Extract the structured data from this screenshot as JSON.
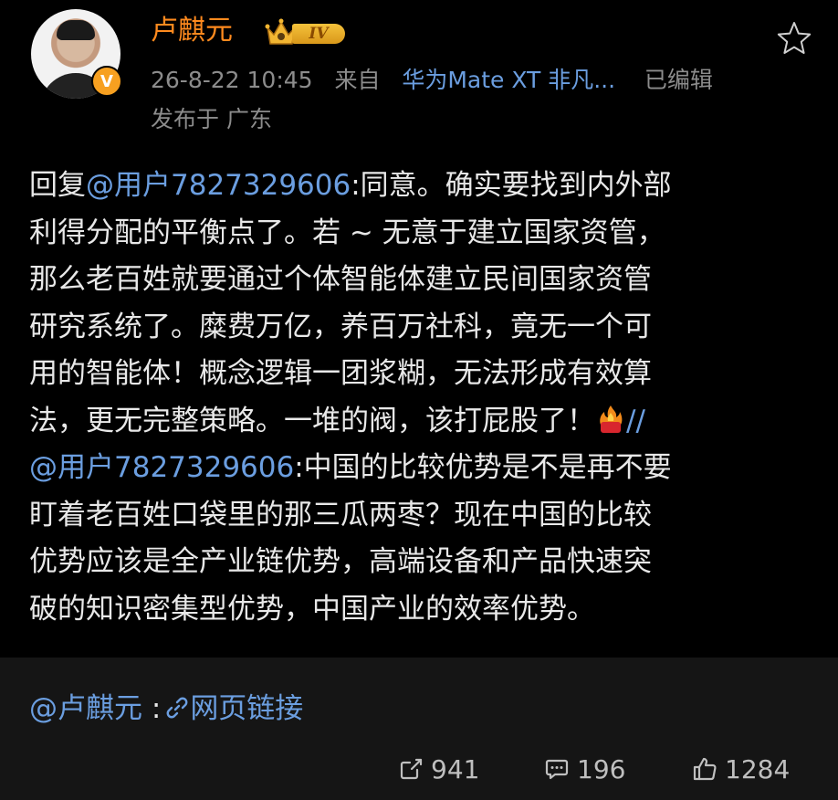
{
  "post": {
    "author": {
      "name": "卢麒元",
      "level": "IV",
      "verified": "V"
    },
    "meta": {
      "timestamp": "26-8-22 10:45",
      "from_label": "来自",
      "device": "华为Mate XT 非凡...",
      "edited": "已编辑",
      "location": "发布于 广东"
    },
    "body_lines": [
      {
        "prefix": "回复",
        "mention": "@用户7827329606",
        "text": ":同意。确实要找到内外部"
      },
      {
        "text": "利得分配的平衡点了。若 ~ 无意于建立国家资管，"
      },
      {
        "text": "那么老百姓就要通过个体智能体建立民间国家资管"
      },
      {
        "text": "研究系统了。糜费万亿，养百万社科，竟无一个可"
      },
      {
        "text": "用的智能体！概念逻辑一团浆糊，无法形成有效算"
      },
      {
        "text": "法，更无完整策略。一堆的阀，该打屁股了！",
        "suffix": "//"
      },
      {
        "mention": "@用户7827329606",
        "text": ":中国的比较优势是不是再不要"
      },
      {
        "text": "盯着老百姓口袋里的那三瓜两枣？现在中国的比较"
      },
      {
        "text": "优势应该是全产业链优势，高端设备和产品快速突"
      },
      {
        "text": "破的知识密集型优势，中国产业的效率优势。"
      }
    ],
    "source": {
      "mention": "@卢麒元",
      "sep": ":",
      "link_label": "网页链接"
    },
    "actions": {
      "reposts": "941",
      "comments": "196",
      "likes": "1284"
    }
  },
  "colors": {
    "background": "#000000",
    "username": "#ff8a1e",
    "link": "#6b9ee0",
    "meta": "#8c8c8c",
    "text": "#e8e8e8",
    "footer_bg": "#151515"
  },
  "icons": [
    "star-icon",
    "crown-icon",
    "verified-icon",
    "fire-emoji-icon",
    "link-icon",
    "repost-icon",
    "comment-icon",
    "like-icon"
  ]
}
